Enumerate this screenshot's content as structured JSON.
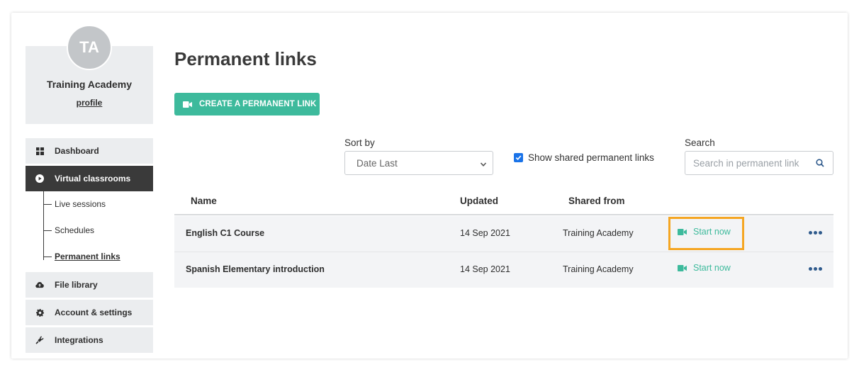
{
  "profile": {
    "initials": "TA",
    "name": "Training Academy",
    "link": "profile"
  },
  "sidebar": {
    "items": [
      {
        "label": "Dashboard",
        "icon": "grid-icon"
      },
      {
        "label": "Virtual classrooms",
        "icon": "play-circle-icon",
        "active": true
      },
      {
        "label": "File library",
        "icon": "cloud-upload-icon"
      },
      {
        "label": "Account & settings",
        "icon": "gear-icon"
      },
      {
        "label": "Integrations",
        "icon": "plug-icon"
      }
    ],
    "subitems": [
      {
        "label": "Live sessions"
      },
      {
        "label": "Schedules"
      },
      {
        "label": "Permanent links",
        "current": true
      }
    ]
  },
  "main": {
    "title": "Permanent links",
    "create_button": "CREATE A PERMANENT LINK",
    "sort": {
      "label": "Sort by",
      "value": "Date Last"
    },
    "show_shared": {
      "label": "Show shared permanent links",
      "checked": true
    },
    "search": {
      "label": "Search",
      "placeholder": "Search in permanent link"
    }
  },
  "table": {
    "headers": {
      "name": "Name",
      "updated": "Updated",
      "shared": "Shared from"
    },
    "rows": [
      {
        "name": "English C1 Course",
        "updated": "14 Sep 2021",
        "shared": "Training Academy",
        "action": "Start now"
      },
      {
        "name": "Spanish Elementary introduction",
        "updated": "14 Sep 2021",
        "shared": "Training Academy",
        "action": "Start now"
      }
    ]
  },
  "colors": {
    "accent": "#3dba9c",
    "sidebar_active": "#3a3a3a",
    "highlight": "#f5a623",
    "more_dots": "#2f5a8c"
  }
}
